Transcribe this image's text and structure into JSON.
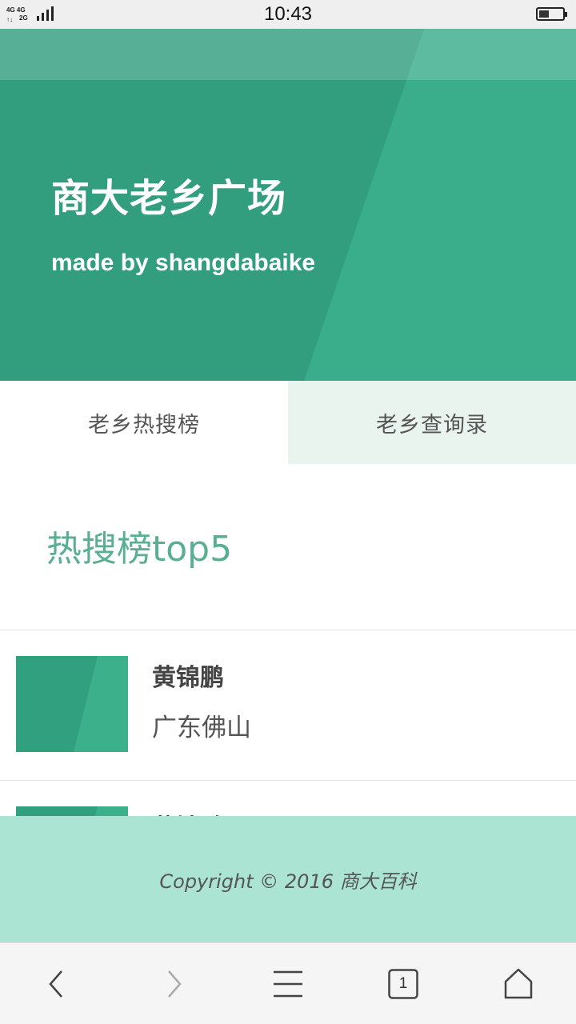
{
  "status_bar": {
    "network_top": "4G 4G",
    "network_bottom": "2G",
    "time": "10:43",
    "icons": [
      "signal-icon",
      "battery-icon"
    ]
  },
  "hero": {
    "title": "商大老乡广场",
    "subtitle": "made by shangdabaike"
  },
  "tabs": [
    {
      "label": "老乡热搜榜",
      "active": true
    },
    {
      "label": "老乡查询录",
      "active": false
    }
  ],
  "section": {
    "title": "热搜榜top5"
  },
  "list": [
    {
      "name": "黄锦鹏",
      "place": "广东佛山"
    },
    {
      "name": "黄锦鹏",
      "place": ""
    }
  ],
  "footer": {
    "copyright": "Copyright © 2016 商大百科"
  },
  "browser_bar": {
    "tab_count": "1",
    "icons": [
      "back-icon",
      "forward-icon",
      "menu-icon",
      "tabs-icon",
      "home-icon"
    ]
  },
  "colors": {
    "hero_green": "#329e7e",
    "hero_light": "#3aae8a",
    "accent_text": "#5aae92",
    "footer_bg": "#abe4d3",
    "tab_inactive_bg": "#eaf4ef"
  }
}
